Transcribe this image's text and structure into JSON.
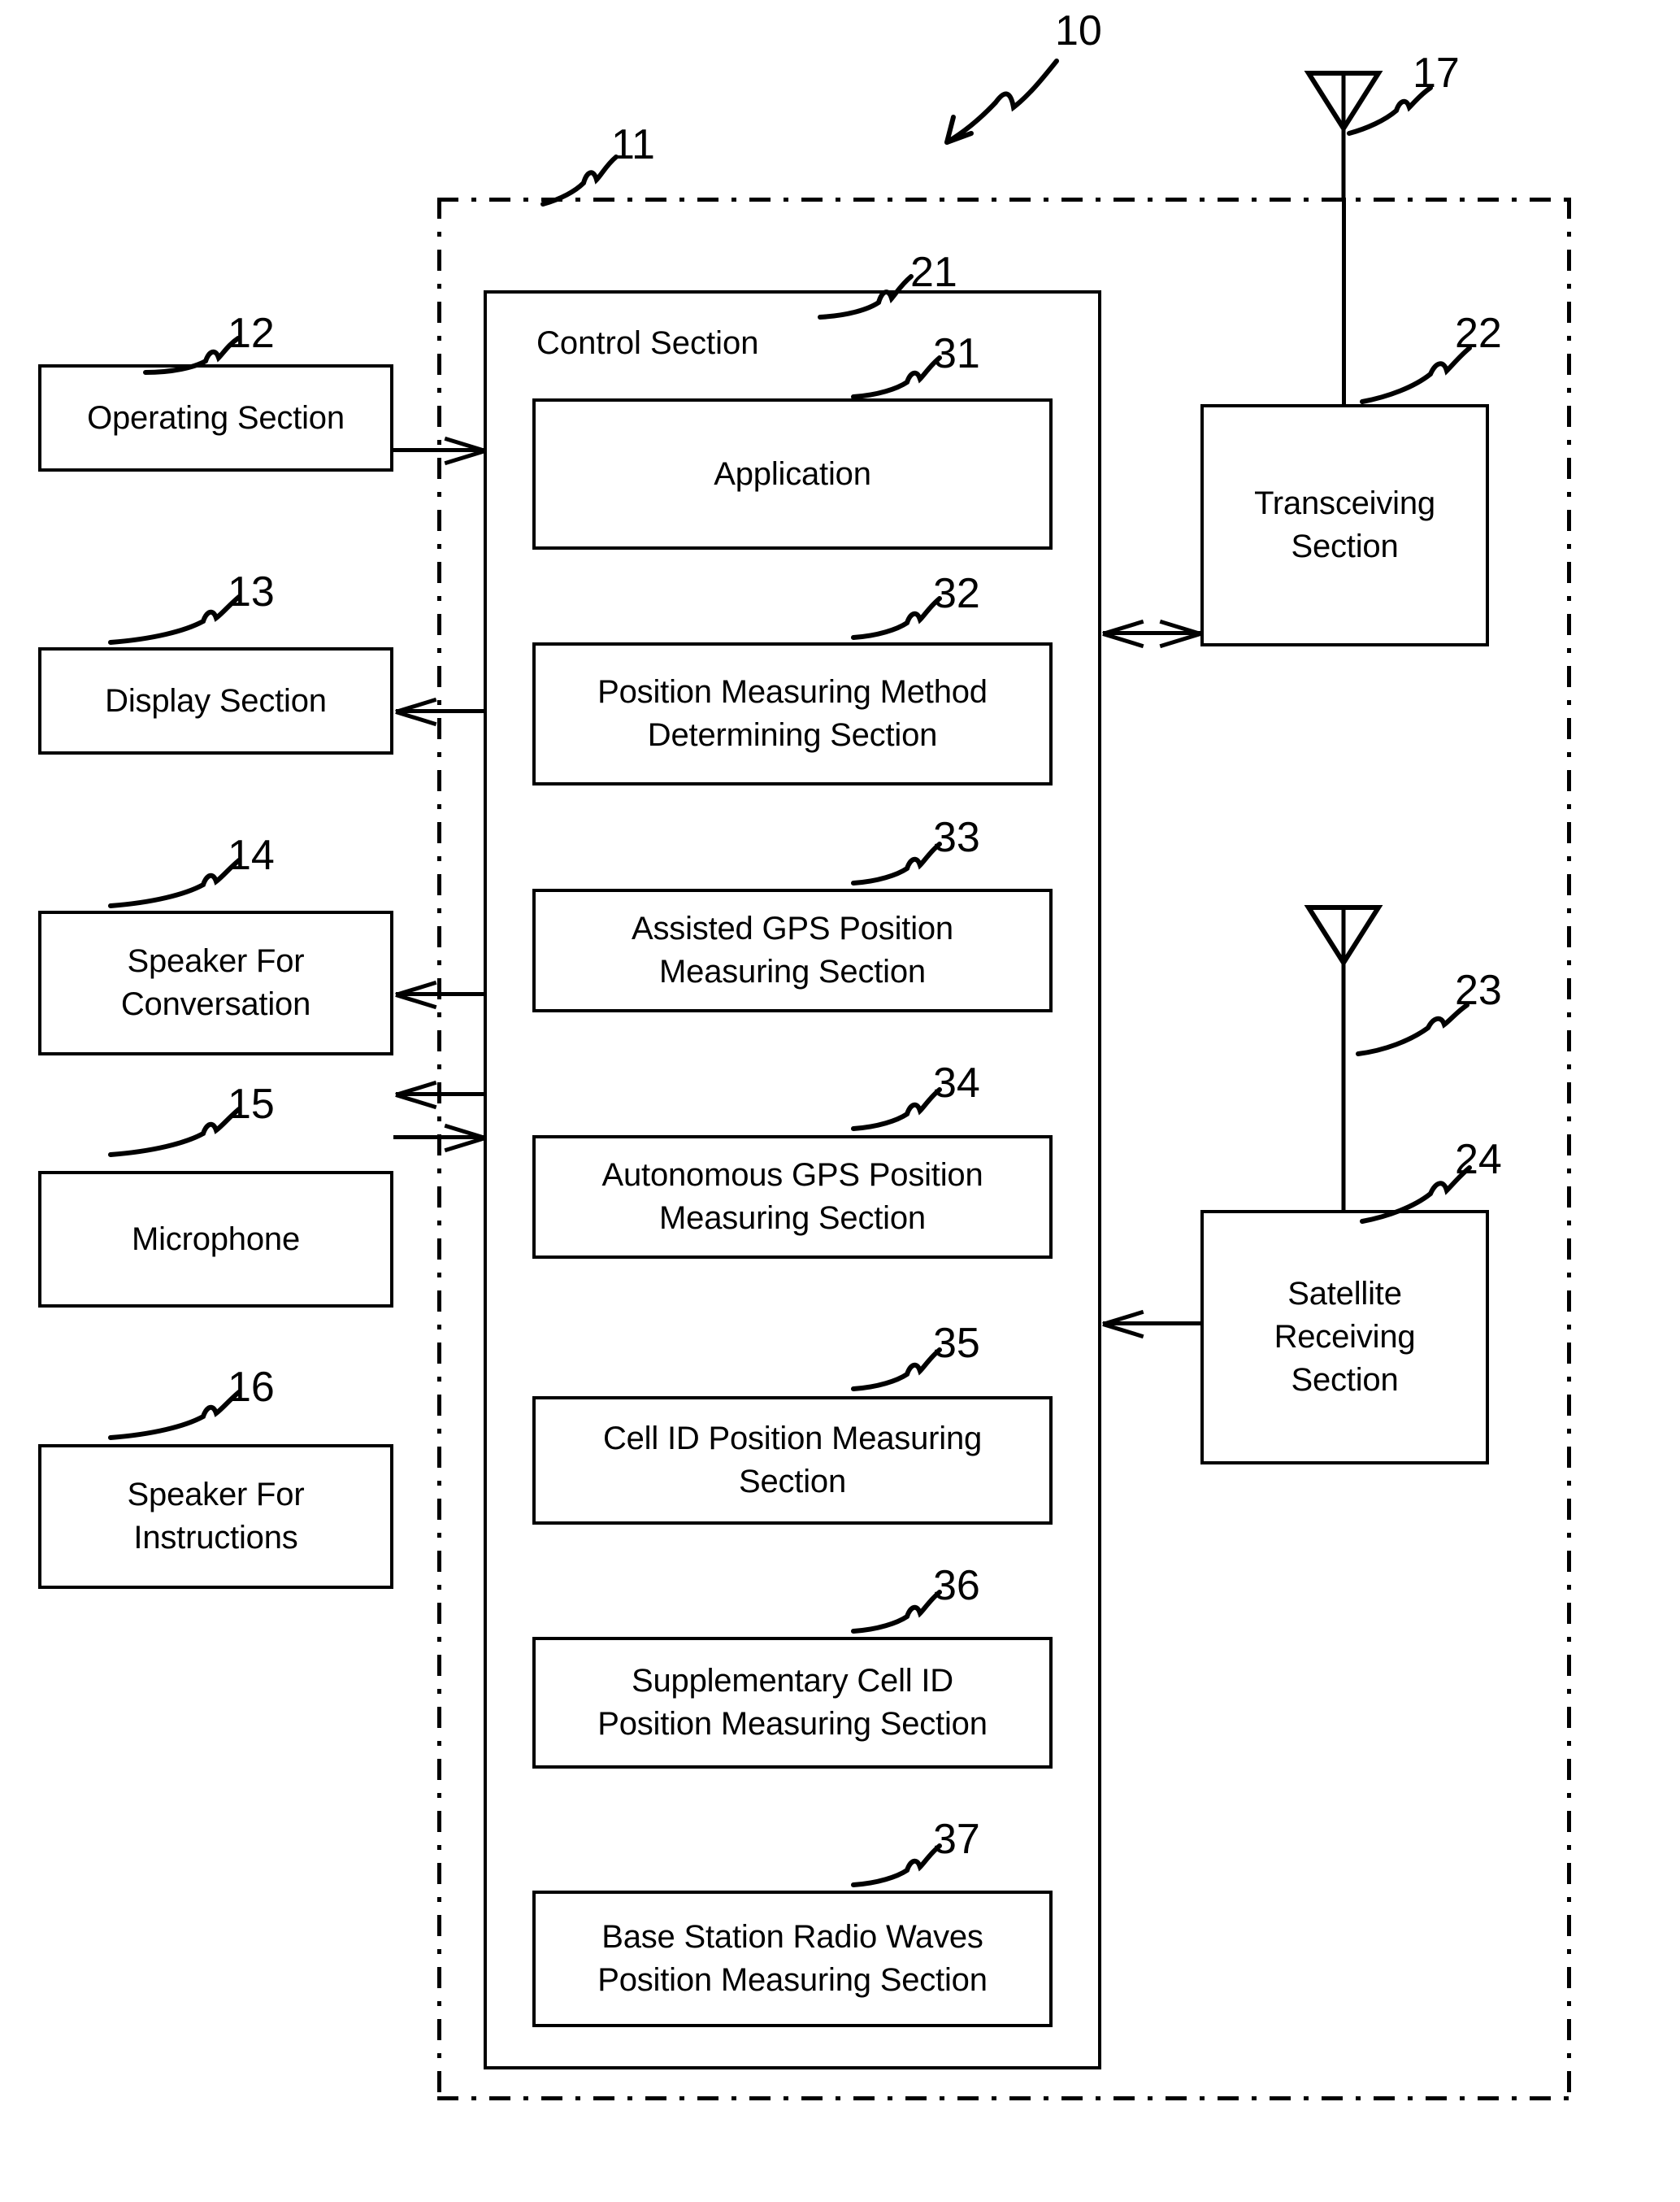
{
  "figure": {
    "kind": "patent-block-diagram",
    "ink_color": "#000000",
    "background_color": "#ffffff"
  },
  "reference_numerals": {
    "system": "10",
    "enclosure": "11",
    "operating_section": "12",
    "display_section": "13",
    "speaker_conversation": "14",
    "microphone": "15",
    "speaker_instructions": "16",
    "antenna_transceiving": "17",
    "control_section": "21",
    "transceiving_section": "22",
    "antenna_satellite": "23",
    "satellite_receiving_section": "24",
    "application": "31",
    "position_method_determining": "32",
    "assisted_gps": "33",
    "autonomous_gps": "34",
    "cell_id": "35",
    "supplementary_cell_id": "36",
    "base_station_radio_waves": "37"
  },
  "left_column": {
    "blocks": [
      {
        "id": "12",
        "label": "Operating Section"
      },
      {
        "id": "13",
        "label": "Display Section"
      },
      {
        "id": "14",
        "label": "Speaker For\nConversation"
      },
      {
        "id": "15",
        "label": "Microphone"
      },
      {
        "id": "16",
        "label": "Speaker For\nInstructions"
      }
    ]
  },
  "control_section": {
    "title": "Control Section",
    "ref": "21",
    "modules": [
      {
        "id": "31",
        "label": "Application"
      },
      {
        "id": "32",
        "label": "Position Measuring Method\nDetermining Section"
      },
      {
        "id": "33",
        "label": "Assisted GPS Position\nMeasuring Section"
      },
      {
        "id": "34",
        "label": "Autonomous GPS Position\nMeasuring Section"
      },
      {
        "id": "35",
        "label": "Cell ID Position Measuring\nSection"
      },
      {
        "id": "36",
        "label": "Supplementary Cell ID\nPosition Measuring Section"
      },
      {
        "id": "37",
        "label": "Base Station Radio Waves\nPosition Measuring Section"
      }
    ]
  },
  "right_column": {
    "blocks": [
      {
        "id": "22",
        "label": "Transceiving\nSection"
      },
      {
        "id": "24",
        "label": "Satellite\nReceiving\nSection"
      }
    ],
    "antennas": [
      {
        "id": "17",
        "name": "antenna-transceiving"
      },
      {
        "id": "23",
        "name": "antenna-satellite"
      }
    ]
  },
  "connections": [
    {
      "from": "Operating Section",
      "to": "Control Section",
      "direction": "right"
    },
    {
      "from": "Control Section",
      "to": "Display Section",
      "direction": "left"
    },
    {
      "from": "Control Section",
      "to": "Speaker For Conversation",
      "direction": "left"
    },
    {
      "from": "Control Section",
      "to": "Speaker For Instructions",
      "direction": "left"
    },
    {
      "from": "Microphone",
      "to": "Control Section",
      "direction": "right"
    },
    {
      "from": "Control Section",
      "to": "Transceiving Section",
      "direction": "both"
    },
    {
      "from": "Satellite Receiving Section",
      "to": "Control Section",
      "direction": "left"
    }
  ]
}
